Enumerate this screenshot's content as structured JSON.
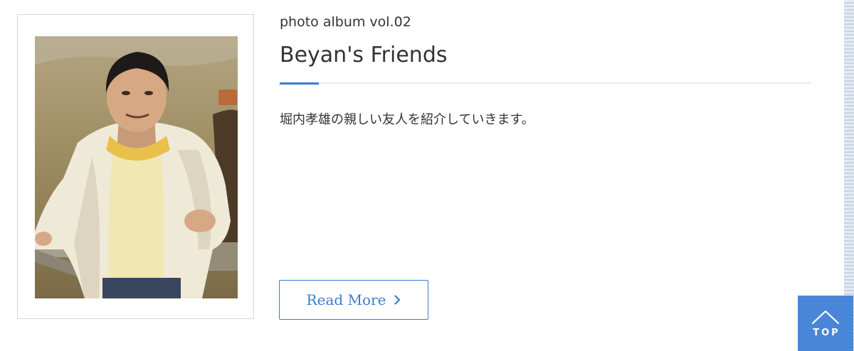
{
  "article": {
    "kicker": "photo album vol.02",
    "title": "Beyan's Friends",
    "description": "堀内孝雄の親しい友人を紹介していきます。",
    "read_more_label": "Read More",
    "read_more_icon": "chevron-right-icon"
  },
  "photo": {
    "subject": "man in cream jacket leaning on wooden fence"
  },
  "top_button": {
    "label": "TOP",
    "icon": "chevron-up-icon"
  },
  "colors": {
    "accent": "#3a7ccf",
    "top_button_bg": "#4a86d8",
    "text": "#333333",
    "rule": "#e4ebf5"
  }
}
